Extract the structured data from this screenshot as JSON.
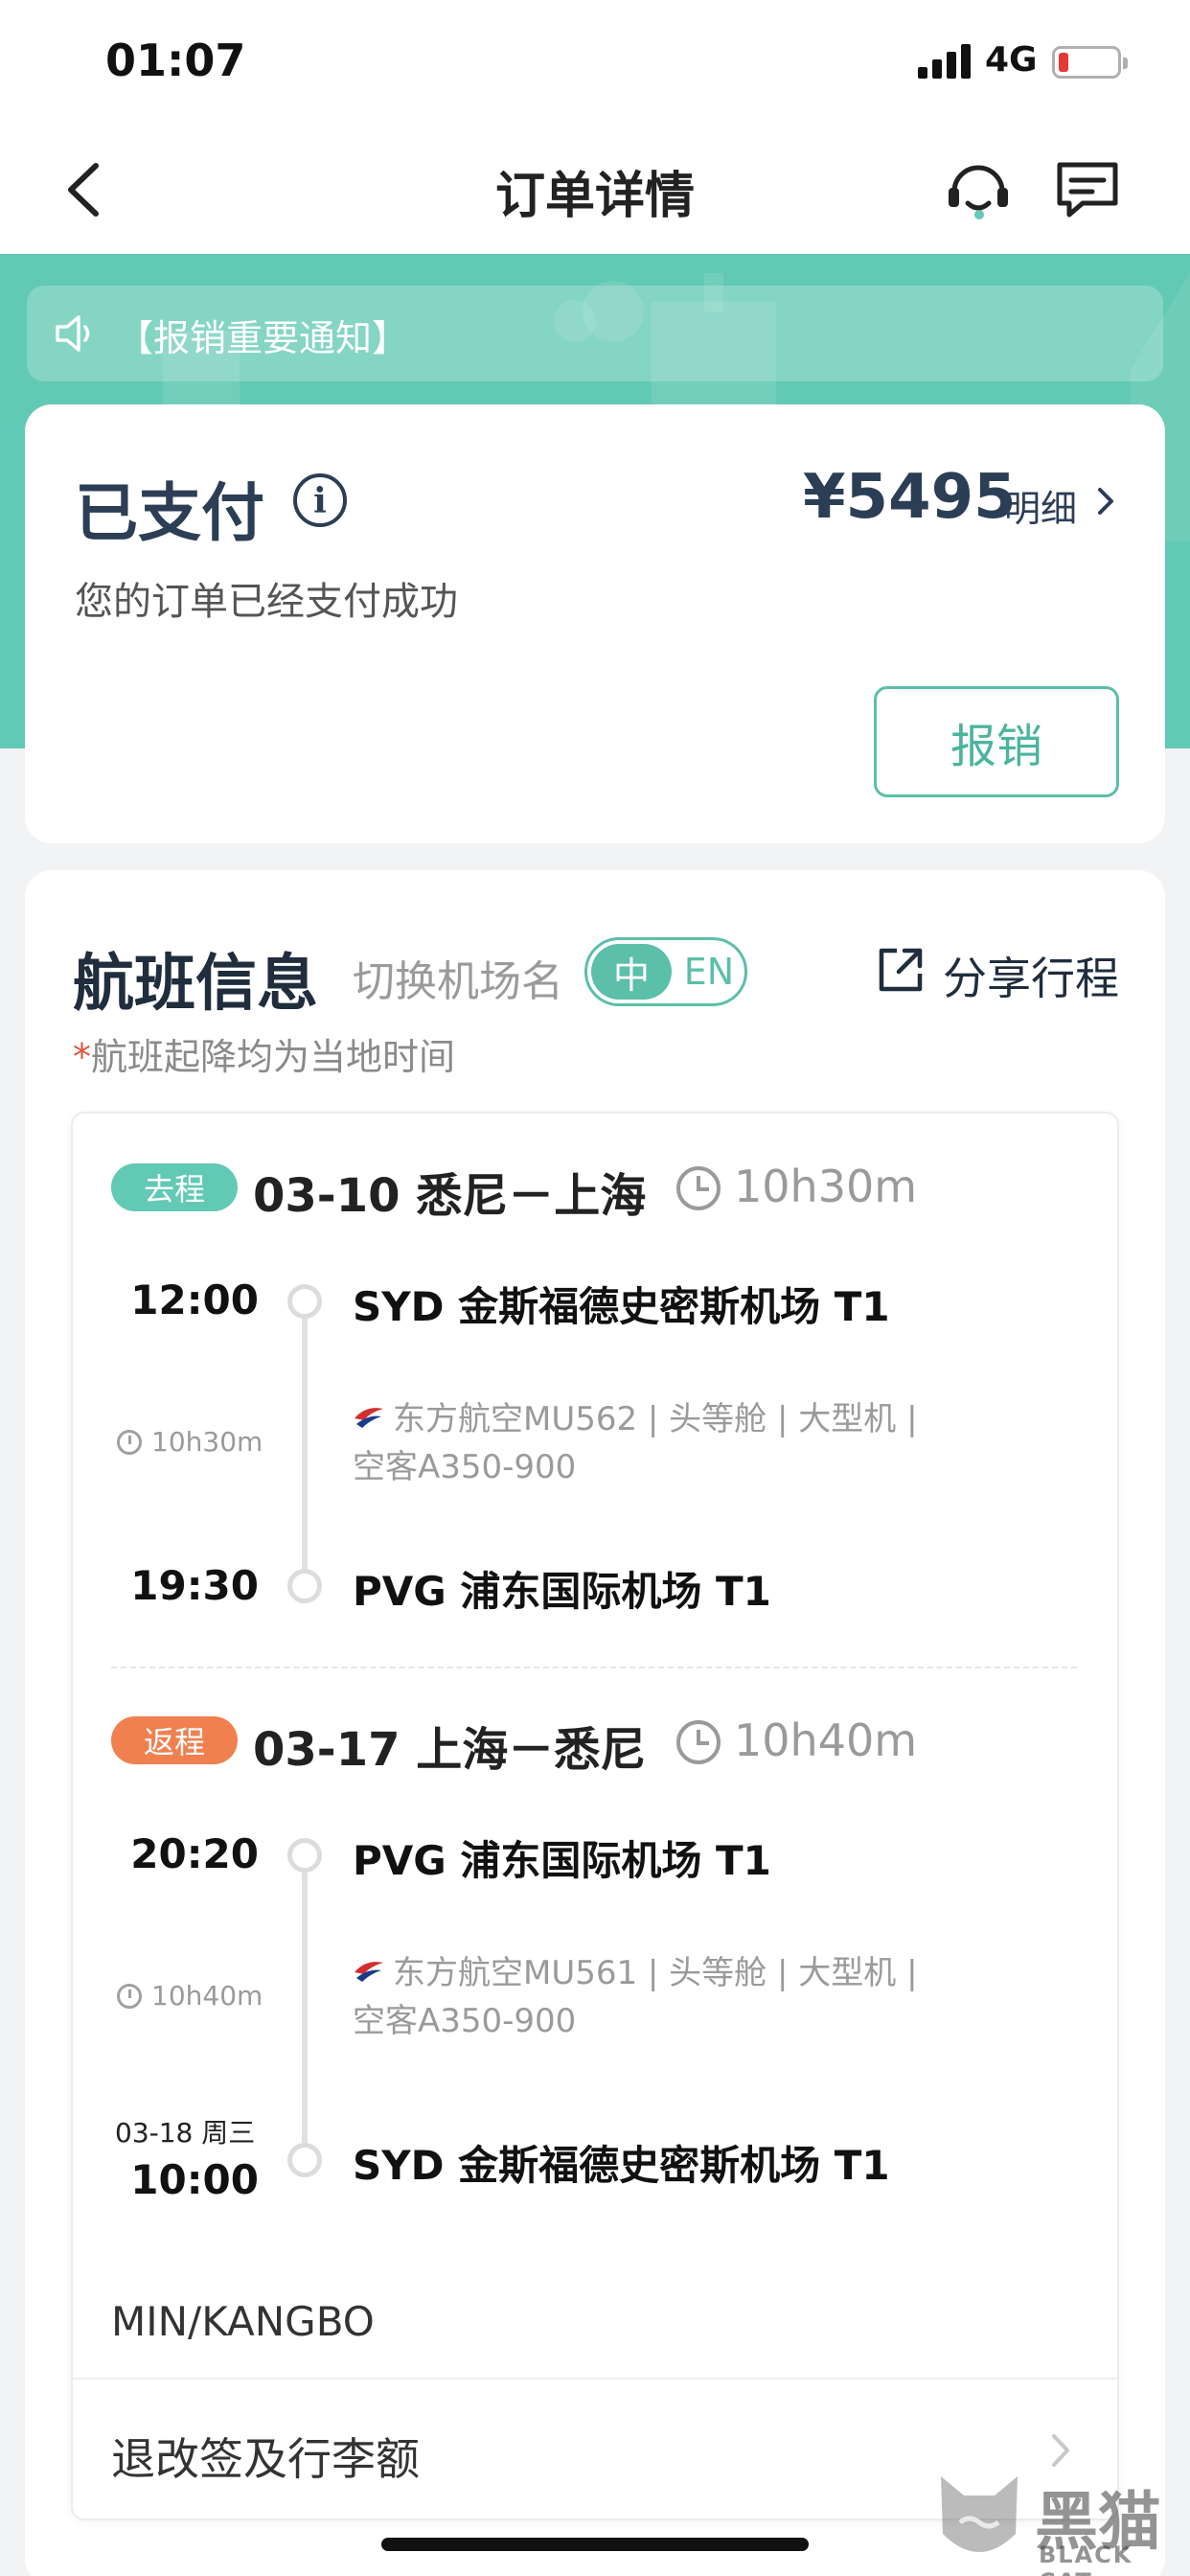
{
  "status_bar": {
    "time": "01:07",
    "network": "4G"
  },
  "nav": {
    "title": "订单详情"
  },
  "notice": {
    "text": "【报销重要通知】"
  },
  "order": {
    "status": "已支付",
    "price": "¥5495",
    "detail_label": "明细",
    "status_desc": "您的订单已经支付成功",
    "reimburse_label": "报销"
  },
  "flight_section": {
    "title": "航班信息",
    "switch_label": "切换机场名",
    "toggle_on": "中",
    "toggle_off": "EN",
    "share_label": "分享行程",
    "note_star": "*",
    "note_text": "航班起降均为当地时间",
    "segments": [
      {
        "badge": "去程",
        "route": "03-10 悉尼－上海",
        "duration": "10h30m",
        "dep_time": "12:00",
        "dep_airport": "SYD 金斯福德史密斯机场 T1",
        "flight_duration": "10h30m",
        "flight_info": "东方航空MU562 | 头等舱 | 大型机 | 空客A350-900",
        "arr_date": "",
        "arr_time": "19:30",
        "arr_airport": "PVG 浦东国际机场 T1"
      },
      {
        "badge": "返程",
        "route": "03-17 上海－悉尼",
        "duration": "10h40m",
        "dep_time": "20:20",
        "dep_airport": "PVG 浦东国际机场 T1",
        "flight_duration": "10h40m",
        "flight_info": "东方航空MU561 | 头等舱 | 大型机 | 空客A350-900",
        "arr_date": "03-18 周三",
        "arr_time": "10:00",
        "arr_airport": "SYD 金斯福德史密斯机场 T1"
      }
    ],
    "passenger": "MIN/KANGBO",
    "change_label": "退改签及行李额"
  },
  "watermark": {
    "text": "黑猫",
    "sub": "BLACK CAT"
  },
  "colors": {
    "accent": "#62c9b4",
    "return_badge": "#f0804f",
    "title_dark": "#2c3e55"
  }
}
